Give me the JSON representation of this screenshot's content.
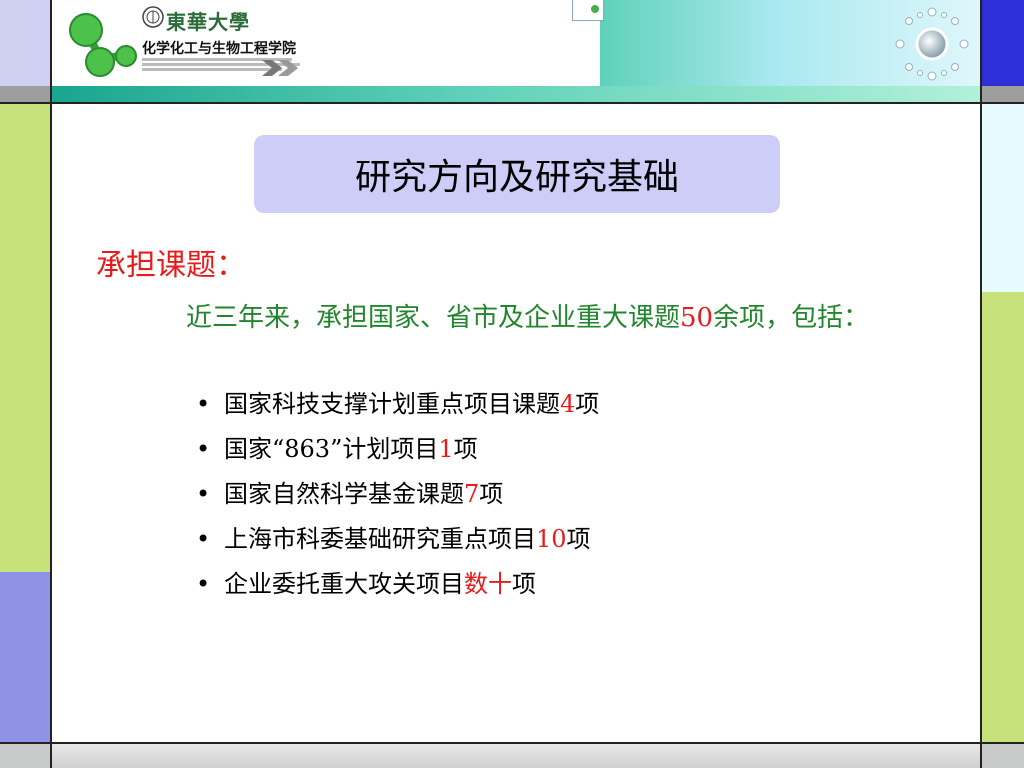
{
  "header": {
    "university_name": "東華大學",
    "college_name": "化学化工与生物工程学院"
  },
  "title": "研究方向及研究基础",
  "section_heading": "承担课题：",
  "intro": {
    "before": "近三年来，承担国家、省市及企业重大课题",
    "number": "50",
    "after": "余项，包括："
  },
  "bullets": [
    {
      "before": "国家科技支撑计划重点项目课题",
      "highlight": "4",
      "after": "项"
    },
    {
      "before": "国家“863”计划项目",
      "highlight": "1",
      "after": "项"
    },
    {
      "before": "国家自然科学基金课题",
      "highlight": "7",
      "after": "项"
    },
    {
      "before": "上海市科委基础研究重点项目",
      "highlight": "10",
      "after": "项"
    },
    {
      "before": "企业委托重大攻关项目",
      "highlight": "数十",
      "after": "项"
    }
  ],
  "colors": {
    "title_box": "#cdcdf7",
    "heading": "#e61c1c",
    "intro_text": "#22862e",
    "highlight": "#e61c1c"
  }
}
